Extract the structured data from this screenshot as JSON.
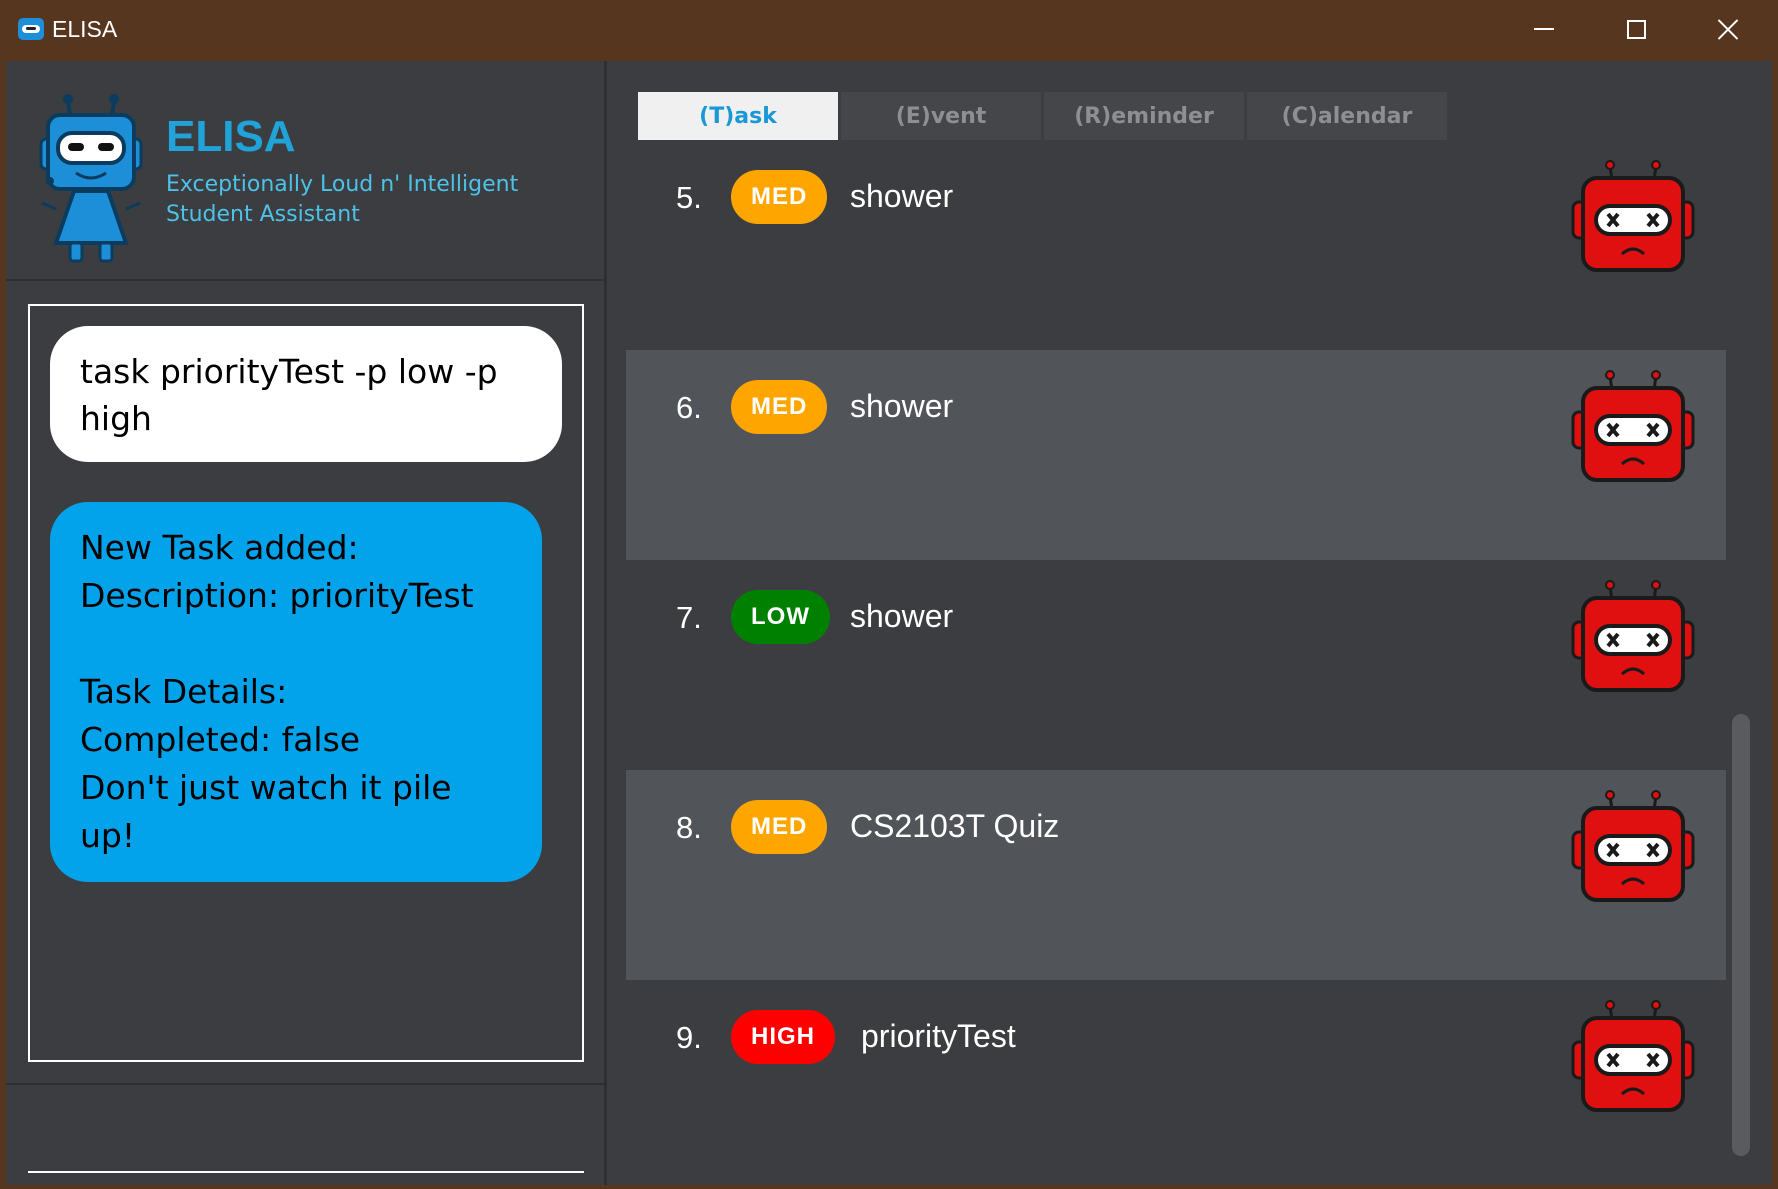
{
  "window": {
    "title": "ELISA"
  },
  "header": {
    "brand": "ELISA",
    "tagline": "Exceptionally Loud n' Intelligent Student Assistant"
  },
  "chat": {
    "user_message": "task priorityTest -p low -p high",
    "bot_message": "New Task added:\nDescription: priorityTest\n\nTask Details:\nCompleted: false\nDon't just watch it pile up!"
  },
  "tabs": [
    {
      "label": "(T)ask",
      "active": true
    },
    {
      "label": "(E)vent",
      "active": false
    },
    {
      "label": "(R)eminder",
      "active": false
    },
    {
      "label": "(C)alendar",
      "active": false
    }
  ],
  "tasks": [
    {
      "number": "5.",
      "priority": "MED",
      "description": "shower",
      "status_icon": "incomplete-robot-icon"
    },
    {
      "number": "6.",
      "priority": "MED",
      "description": "shower",
      "status_icon": "incomplete-robot-icon"
    },
    {
      "number": "7.",
      "priority": "LOW",
      "description": "shower",
      "status_icon": "incomplete-robot-icon"
    },
    {
      "number": "8.",
      "priority": "MED",
      "description": "CS2103T Quiz",
      "status_icon": "incomplete-robot-icon"
    },
    {
      "number": "9.",
      "priority": "HIGH",
      "description": "priorityTest",
      "status_icon": "incomplete-robot-icon"
    }
  ],
  "colors": {
    "titlebar": "#56361f",
    "background": "#3c3d40",
    "accent": "#20a3d9",
    "bot_bubble": "#03a3eb",
    "priority_med": "#ffa500",
    "priority_low": "#008000",
    "priority_high": "#ff0000"
  }
}
